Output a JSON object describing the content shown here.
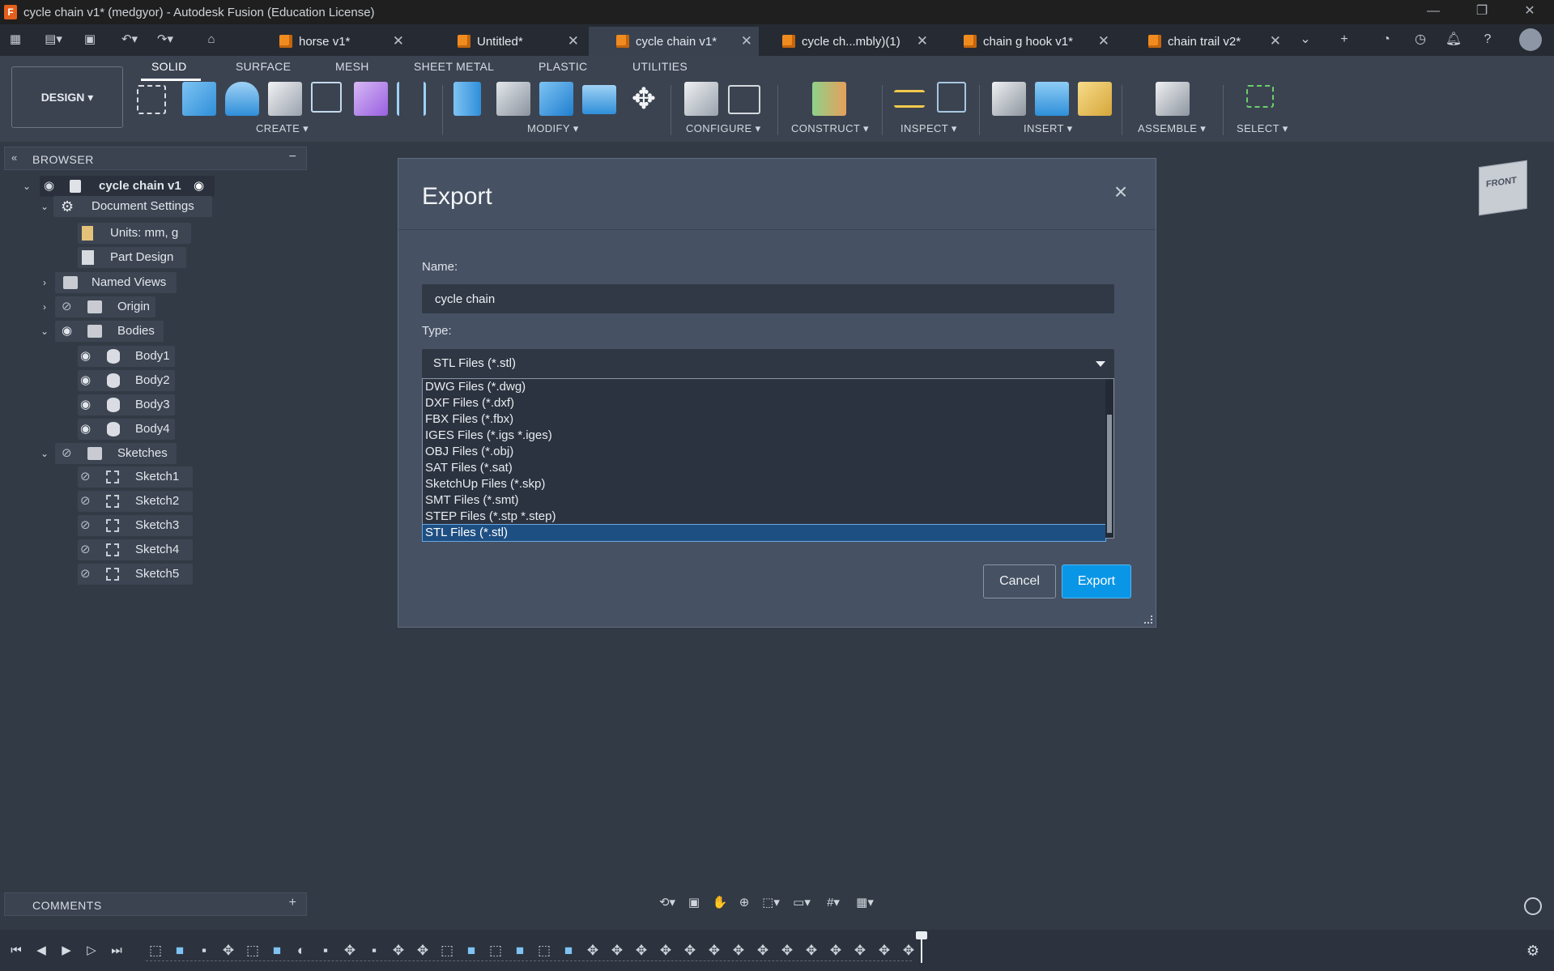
{
  "window": {
    "title": "cycle chain v1* (medgyor) - Autodesk Fusion (Education License)",
    "app_icon": "F",
    "controls": [
      "—",
      "❐",
      "✕"
    ]
  },
  "tabs": [
    {
      "label": "horse v1*",
      "active": false
    },
    {
      "label": "Untitled*",
      "active": false
    },
    {
      "label": "cycle chain v1*",
      "active": true
    },
    {
      "label": "cycle ch...mbly)(1)",
      "active": false
    },
    {
      "label": "chain g hook v1*",
      "active": false
    },
    {
      "label": "chain trail v2*",
      "active": false
    }
  ],
  "toolbar": {
    "design_label": "DESIGN",
    "workspace_tabs": [
      "SOLID",
      "SURFACE",
      "MESH",
      "SHEET METAL",
      "PLASTIC",
      "UTILITIES"
    ],
    "groups": [
      "CREATE",
      "MODIFY",
      "CONFIGURE",
      "CONSTRUCT",
      "INSPECT",
      "INSERT",
      "ASSEMBLE",
      "SELECT"
    ]
  },
  "browser": {
    "title": "BROWSER",
    "root": "cycle chain v1",
    "document_settings": "Document Settings",
    "units": "Units: mm, g",
    "part_design": "Part Design",
    "named_views": "Named Views",
    "origin": "Origin",
    "bodies_label": "Bodies",
    "bodies": [
      "Body1",
      "Body2",
      "Body3",
      "Body4"
    ],
    "sketches_label": "Sketches",
    "sketches": [
      "Sketch1",
      "Sketch2",
      "Sketch3",
      "Sketch4",
      "Sketch5"
    ]
  },
  "dialog": {
    "title": "Export",
    "name_label": "Name:",
    "name_value": "cycle chain",
    "type_label": "Type:",
    "type_value": "STL Files (*.stl)",
    "options": [
      "DWG Files (*.dwg)",
      "DXF Files (*.dxf)",
      "FBX Files (*.fbx)",
      "IGES Files (*.igs *.iges)",
      "OBJ Files (*.obj)",
      "SAT Files (*.sat)",
      "SketchUp Files (*.skp)",
      "SMT Files (*.smt)",
      "STEP Files (*.stp *.step)",
      "STL Files (*.stl)"
    ],
    "selected_option": "STL Files (*.stl)",
    "cancel_label": "Cancel",
    "export_label": "Export"
  },
  "viewcube": {
    "label": "FRONT"
  },
  "comments": {
    "title": "COMMENTS"
  },
  "colors": {
    "accent": "#0a96e6",
    "selection": "#1e4f82",
    "tab_icon": "#f08c1f"
  }
}
